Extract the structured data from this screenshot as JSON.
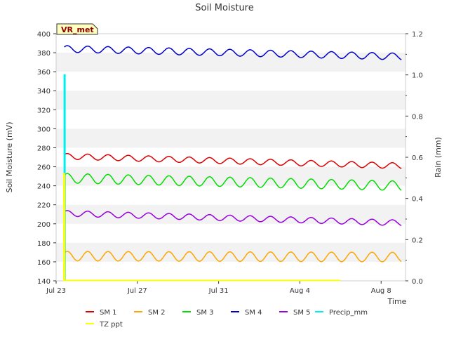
{
  "chart_data": {
    "type": "line",
    "title": "Soil Moisture",
    "site_label": "VR_met",
    "xlabel": "Time",
    "ylabel_left": "Soil Moisture (mV)",
    "ylabel_right": "Rain (mm)",
    "x_range_days": [
      0,
      17.2
    ],
    "x_ticks": [
      {
        "day": 0,
        "label": "Jul 23"
      },
      {
        "day": 4,
        "label": "Jul 27"
      },
      {
        "day": 8,
        "label": "Jul 31"
      },
      {
        "day": 12,
        "label": "Aug 4"
      },
      {
        "day": 16,
        "label": "Aug 8"
      }
    ],
    "ylim_left": [
      140,
      400
    ],
    "yticks_left": [
      140,
      160,
      180,
      200,
      220,
      240,
      260,
      280,
      300,
      320,
      340,
      360,
      380,
      400
    ],
    "ylim_right": [
      0,
      1.2
    ],
    "yticks_right": [
      0.0,
      0.2,
      0.4,
      0.6,
      0.8,
      1.0,
      1.2
    ],
    "grid": "horizontal-bands",
    "legend_placement": "bottom",
    "series": [
      {
        "name": "SM 1",
        "color": "#dd0000",
        "axis": "left",
        "x_start": 0.4,
        "x_end": 17.0,
        "start": 271,
        "end": 261,
        "amp": 3.0
      },
      {
        "name": "SM 2",
        "color": "#ffa500",
        "axis": "left",
        "x_start": 0.4,
        "x_end": 17.0,
        "start": 166,
        "end": 165,
        "amp": 5.0
      },
      {
        "name": "SM 3",
        "color": "#00dd00",
        "axis": "left",
        "x_start": 0.4,
        "x_end": 17.0,
        "start": 248,
        "end": 240,
        "amp": 5.0
      },
      {
        "name": "SM 4",
        "color": "#0000cc",
        "axis": "left",
        "x_start": 0.4,
        "x_end": 17.0,
        "start": 384,
        "end": 376,
        "amp": 3.5
      },
      {
        "name": "SM 5",
        "color": "#9900dd",
        "axis": "left",
        "x_start": 0.4,
        "x_end": 17.0,
        "start": 211,
        "end": 201,
        "amp": 3.0
      },
      {
        "name": "Precip_mm",
        "color": "#00eeee",
        "axis": "right",
        "spike_day": 0.4,
        "spike_value": 1.0,
        "baseline": 0.0
      },
      {
        "name": "TZ ppt",
        "color": "#ffff00",
        "axis": "right",
        "spike_day": 0.38,
        "spike_value": 0.52,
        "baseline": 0.0,
        "x_end": 14.0
      }
    ]
  }
}
